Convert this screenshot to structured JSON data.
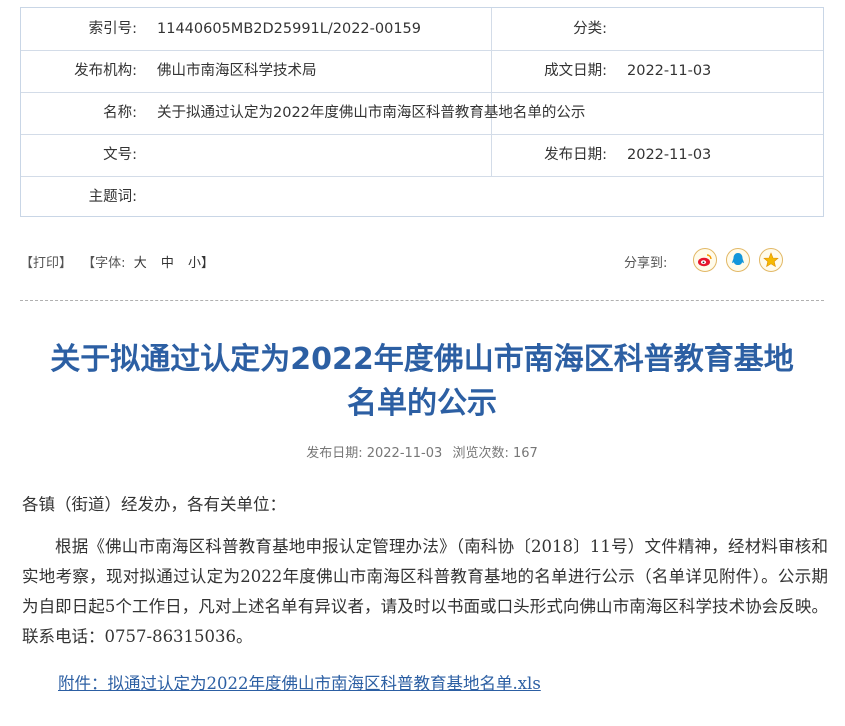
{
  "meta": {
    "index_label": "索引号:",
    "index_value": "11440605MB2D25991L/2022-00159",
    "category_label": "分类:",
    "category_value": "",
    "publisher_label": "发布机构:",
    "publisher_value": "佛山市南海区科学技术局",
    "created_label": "成文日期:",
    "created_value": "2022-11-03",
    "name_label": "名称:",
    "name_value": "关于拟通过认定为2022年度佛山市南海区科普教育基地名单的公示",
    "docno_label": "文号:",
    "docno_value": "",
    "published_label": "发布日期:",
    "published_value": "2022-11-03",
    "keywords_label": "主题词:",
    "keywords_value": ""
  },
  "toolbar": {
    "print": "【打印】",
    "font_open": "【字体:",
    "size_large": "大",
    "size_medium": "中",
    "size_small": "小】",
    "share_label": "分享到:"
  },
  "share_icons": [
    "weibo-icon",
    "qq-icon",
    "qzone-star-icon"
  ],
  "article": {
    "title_line1": "关于拟通过认定为2022年度佛山市南海区科普教育基地",
    "title_line2": "名单的公示",
    "pub_label": "发布日期:",
    "pub_date": "2022-11-03",
    "views_label": "浏览次数:",
    "views": "167",
    "greeting": "各镇（街道）经发办，各有关单位：",
    "paragraph": "根据《佛山市南海区科普教育基地申报认定管理办法》（南科协〔2018〕11号）文件精神，经材料审核和实地考察，现对拟通过认定为2022年度佛山市南海区科普教育基地的名单进行公示（名单详见附件）。公示期为自即日起5个工作日，凡对上述名单有异议者，请及时以书面或口头形式向佛山市南海区科学技术协会反映。联系电话：0757-86315036。",
    "attachment": "附件：拟通过认定为2022年度佛山市南海区科普教育基地名单.xls"
  },
  "colors": {
    "title_blue": "#2c5fa3",
    "border": "#c9d6e6",
    "share_border": "#e2b866"
  }
}
